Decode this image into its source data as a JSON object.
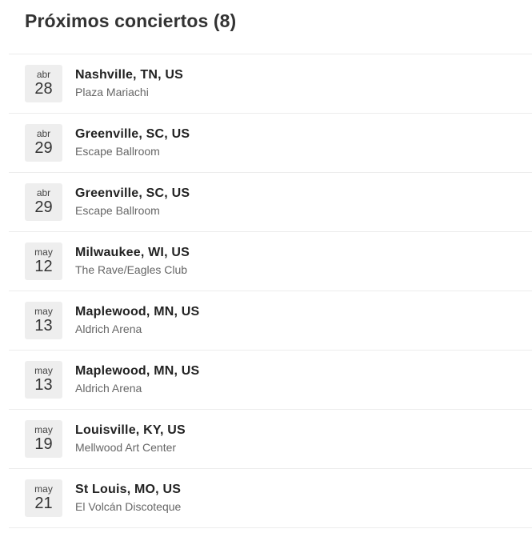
{
  "header": {
    "title": "Próximos conciertos (8)"
  },
  "concerts": [
    {
      "month": "abr",
      "day": "28",
      "city": "Nashville, TN, US",
      "venue": "Plaza Mariachi"
    },
    {
      "month": "abr",
      "day": "29",
      "city": "Greenville, SC, US",
      "venue": "Escape Ballroom"
    },
    {
      "month": "abr",
      "day": "29",
      "city": "Greenville, SC, US",
      "venue": "Escape Ballroom"
    },
    {
      "month": "may",
      "day": "12",
      "city": "Milwaukee, WI, US",
      "venue": "The Rave/Eagles Club"
    },
    {
      "month": "may",
      "day": "13",
      "city": "Maplewood, MN, US",
      "venue": "Aldrich Arena"
    },
    {
      "month": "may",
      "day": "13",
      "city": "Maplewood, MN, US",
      "venue": "Aldrich Arena"
    },
    {
      "month": "may",
      "day": "19",
      "city": "Louisville, KY, US",
      "venue": "Mellwood Art Center"
    },
    {
      "month": "may",
      "day": "21",
      "city": "St Louis, MO, US",
      "venue": "El Volcán Discoteque"
    }
  ]
}
